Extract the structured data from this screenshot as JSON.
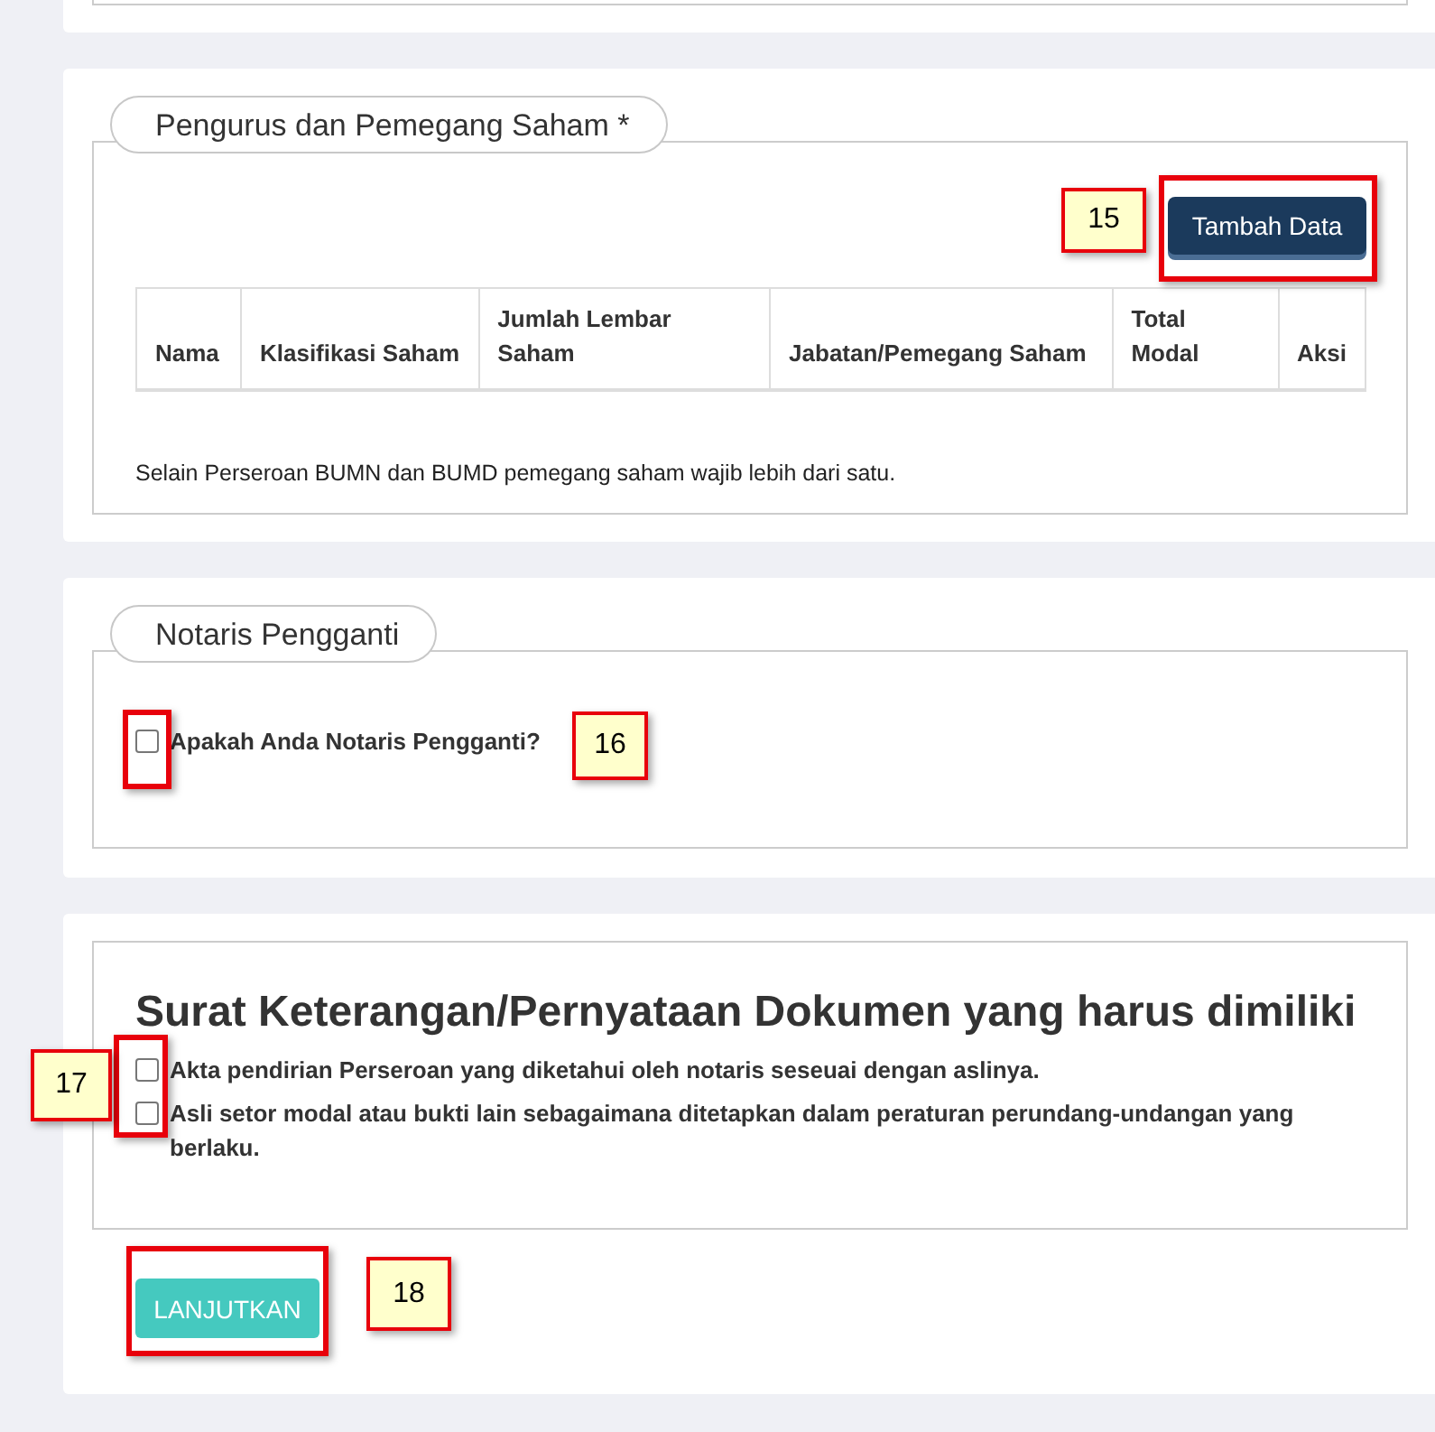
{
  "shareholders": {
    "legend": "Pengurus dan Pemegang Saham *",
    "add_button": "Tambah Data",
    "columns": [
      "Nama",
      "Klasifikasi Saham",
      "Jumlah Lembar Saham",
      "Jabatan/Pemegang Saham",
      "Total Modal",
      "Aksi"
    ],
    "note": "Selain Perseroan BUMN dan BUMD pemegang saham wajib lebih dari satu."
  },
  "substitute_notary": {
    "legend": "Notaris Pengganti",
    "question": "Apakah Anda Notaris Pengganti?",
    "checked": false
  },
  "documents": {
    "heading": "Surat Keterangan/Pernyataan Dokumen yang harus dimiliki",
    "items": [
      {
        "label": "Akta pendirian Perseroan yang diketahui oleh notaris seseuai dengan aslinya.",
        "checked": false
      },
      {
        "label": "Asli setor modal atau bukti lain sebagaimana ditetapkan dalam peraturan perundang-undangan yang berlaku.",
        "checked": false
      }
    ]
  },
  "continue_button": "LANJUTKAN",
  "callouts": [
    {
      "number": "15"
    },
    {
      "number": "16"
    },
    {
      "number": "17"
    },
    {
      "number": "18"
    }
  ]
}
